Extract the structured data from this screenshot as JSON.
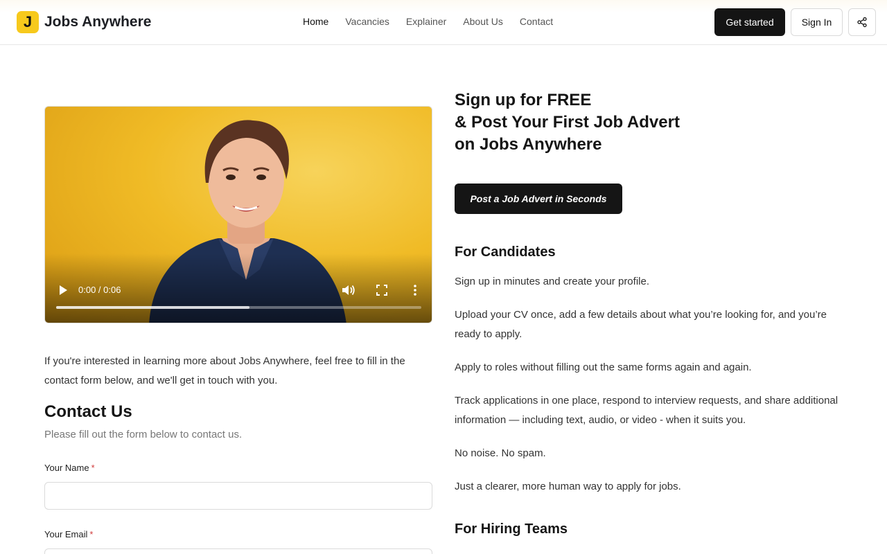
{
  "header": {
    "logo_letter": "J",
    "brand": "Jobs Anywhere",
    "nav": [
      {
        "label": "Home"
      },
      {
        "label": "Vacancies"
      },
      {
        "label": "Explainer"
      },
      {
        "label": "About Us"
      },
      {
        "label": "Contact"
      }
    ],
    "get_started": "Get started",
    "sign_in": "Sign In",
    "share_icon": "share-icon"
  },
  "video": {
    "time": "0:00 / 0:06",
    "progress": 0.53
  },
  "left": {
    "intro": "If you're interested in learning more about Jobs Anywhere, feel free to fill in the contact form below, and we'll get in touch with you.",
    "contact_title": "Contact Us",
    "contact_sub": "Please fill out the form below to contact us.",
    "name_label": "Your Name",
    "email_label": "Your Email",
    "required_mark": "*",
    "name_value": "",
    "email_value": ""
  },
  "right": {
    "headline_1": "Sign up for FREE",
    "headline_2": "& Post Your First Job Advert",
    "headline_3": "on Jobs Anywhere",
    "cta": "Post a Job Advert in Seconds",
    "candidates_title": "For Candidates",
    "p1": "Sign up in minutes and create your profile.",
    "p2": "Upload your CV once, add a few details about what you’re looking for, and you’re ready to apply.",
    "p3": "Apply to roles without filling out the same forms again and again.",
    "p4": "Track applications in one place, respond to interview requests, and share additional information — including text, audio, or video - when it suits you.",
    "p5": "No noise. No spam.",
    "p6": "Just a clearer, more human way to apply for jobs.",
    "hiring_title": "For Hiring Teams"
  },
  "colors": {
    "accent": "#f7c91c",
    "dark_button": "#141414",
    "required": "#d03b3b"
  }
}
